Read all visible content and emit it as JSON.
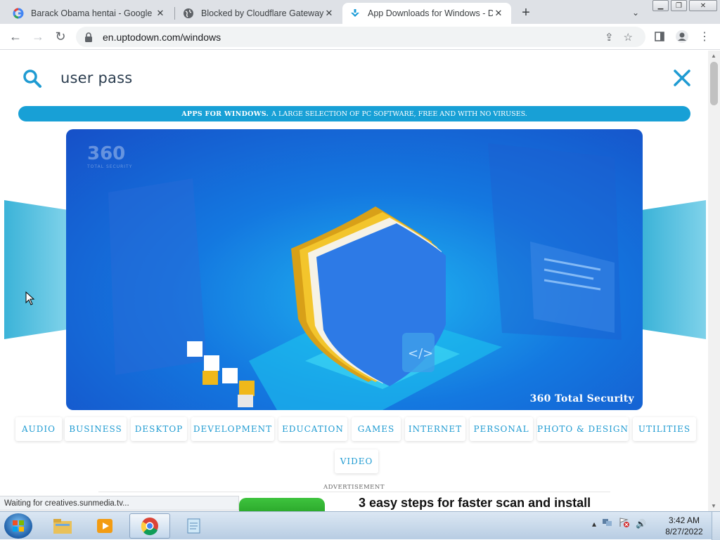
{
  "browser": {
    "tabs": [
      {
        "title": "Barack Obama hentai - Google S",
        "favicon": "google-g-icon",
        "active": false
      },
      {
        "title": "Blocked by Cloudflare Gateway",
        "favicon": "globe-icon",
        "active": false
      },
      {
        "title": "App Downloads for Windows - D",
        "favicon": "uptodown-arrow-icon",
        "active": true
      }
    ],
    "url": "en.uptodown.com/windows"
  },
  "page": {
    "search_query": "user pass",
    "banner_bold": "APPS FOR WINDOWS.",
    "banner_text": "A LARGE SELECTION OF PC SOFTWARE, FREE AND WITH NO VIRUSES.",
    "hero_caption": "360 Total Security",
    "hero_logo": "360",
    "hero_logo_sub": "TOTAL SECURITY",
    "categories": [
      "AUDIO",
      "BUSINESS",
      "DESKTOP",
      "DEVELOPMENT",
      "EDUCATION",
      "GAMES",
      "INTERNET",
      "PERSONAL",
      "PHOTO & DESIGN",
      "UTILITIES",
      "VIDEO"
    ],
    "ad_label": "ADVERTISEMENT",
    "ad_headline": "3 easy steps for faster scan and install"
  },
  "status_text": "Waiting for creatives.sunmedia.tv...",
  "taskbar": {
    "time": "3:42 AM",
    "date": "8/27/2022"
  },
  "colors": {
    "accent": "#18a0d6",
    "search_icon": "#1f9bd2",
    "hero_blue": "#1478e0"
  }
}
